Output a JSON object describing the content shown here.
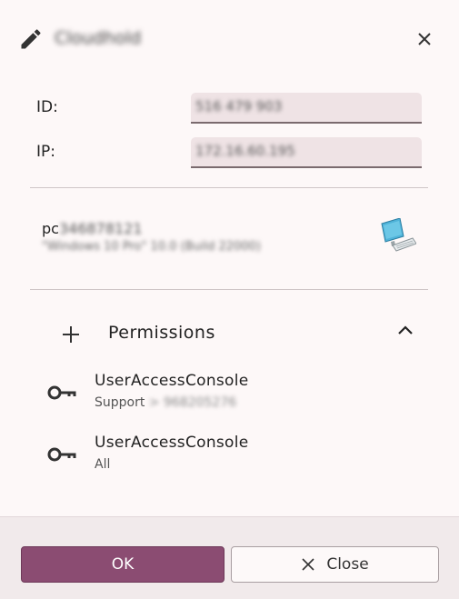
{
  "header": {
    "title": "Cloudhold"
  },
  "fields": {
    "id_label": "ID:",
    "id_value": "516 479 903",
    "ip_label": "IP:",
    "ip_value": "172.16.60.195"
  },
  "device": {
    "name_prefix": "pc",
    "name_suffix": "346878121",
    "os": "\"Windows 10 Pro\" 10.0 (Build 22000)",
    "icon": "computer-icon"
  },
  "permissions": {
    "title": "Permissions",
    "items": [
      {
        "name": "UserAccessConsole",
        "scope": "Support",
        "scope_detail": "> 968205276"
      },
      {
        "name": "UserAccessConsole",
        "scope": "All",
        "scope_detail": ""
      }
    ]
  },
  "footer": {
    "ok_label": "OK",
    "close_label": "Close"
  },
  "colors": {
    "accent": "#8b4c72",
    "background": "#fdf8f8",
    "input_bg": "#efe3e5"
  }
}
